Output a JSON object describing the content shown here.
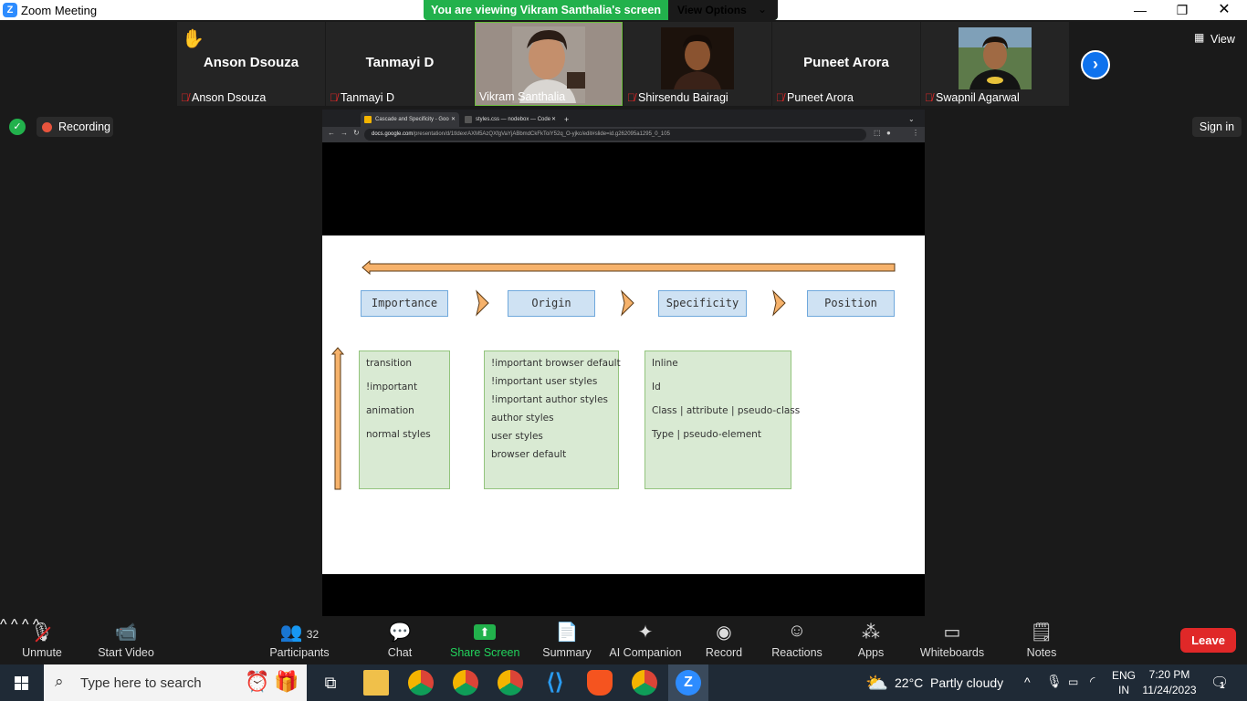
{
  "window": {
    "title": "Zoom Meeting"
  },
  "banner": {
    "viewing_text": "You are viewing Vikram Santhalia's screen",
    "options_label": "View Options"
  },
  "gallery": {
    "participants": [
      {
        "name": "Anson Dsouza",
        "label": "Anson Dsouza",
        "hand_raised": true,
        "video": false,
        "muted": true
      },
      {
        "name": "Tanmayi D",
        "label": "Tanmayi D",
        "video": false,
        "muted": true
      },
      {
        "name": "Vikram Santhalia",
        "label": "Vikram Santhalia",
        "video": true,
        "muted": false,
        "active_speaker": true
      },
      {
        "name": "Shirsendu Bairagi",
        "label": "Shirsendu Bairagi",
        "video": true,
        "muted": true
      },
      {
        "name": "Puneet Arora",
        "label": "Puneet Arora",
        "video": false,
        "muted": true
      },
      {
        "name": "Swapnil Agarwal",
        "label": "Swapnil Agarwal",
        "video": true,
        "muted": true
      }
    ],
    "view_label": "View"
  },
  "status": {
    "recording_label": "Recording",
    "signin_label": "Sign in"
  },
  "shared_browser": {
    "tabs": [
      "Cascade and Specificity - Goo",
      "styles.css — nodebox — Code"
    ],
    "url_host": "docs.google.com",
    "url_path": "/presentation/d/1tIdexrAXM5AzQXfgVaYjABbmdCkFkToiY52q_O-yjkc/edit#slide=id.g262095a1295_0_105"
  },
  "slide": {
    "headers": [
      "Importance",
      "Origin",
      "Specificity",
      "Position"
    ],
    "columns": [
      [
        "transition",
        "!important",
        "animation",
        "normal styles"
      ],
      [
        "!important browser default",
        "!important user styles",
        "!important author styles",
        "author styles",
        "user styles",
        "browser default"
      ],
      [
        "Inline",
        "Id",
        "Class | attribute | pseudo-class",
        "Type | pseudo-element"
      ]
    ]
  },
  "toolbar": {
    "unmute": "Unmute",
    "start_video": "Start Video",
    "participants": "Participants",
    "participants_count": "32",
    "chat": "Chat",
    "share_screen": "Share Screen",
    "summary": "Summary",
    "ai_companion": "AI Companion",
    "record": "Record",
    "reactions": "Reactions",
    "apps": "Apps",
    "whiteboards": "Whiteboards",
    "notes": "Notes",
    "leave": "Leave"
  },
  "taskbar": {
    "search_placeholder": "Type here to search",
    "weather_temp": "22°C",
    "weather_desc": "Partly cloudy",
    "lang": "ENG",
    "region": "IN",
    "time": "7:20 PM",
    "date": "11/24/2023",
    "notifications": "1"
  },
  "colors": {
    "zoom_blue": "#0e72ed",
    "banner_green": "#22b14c",
    "leave_red": "#e02828"
  }
}
